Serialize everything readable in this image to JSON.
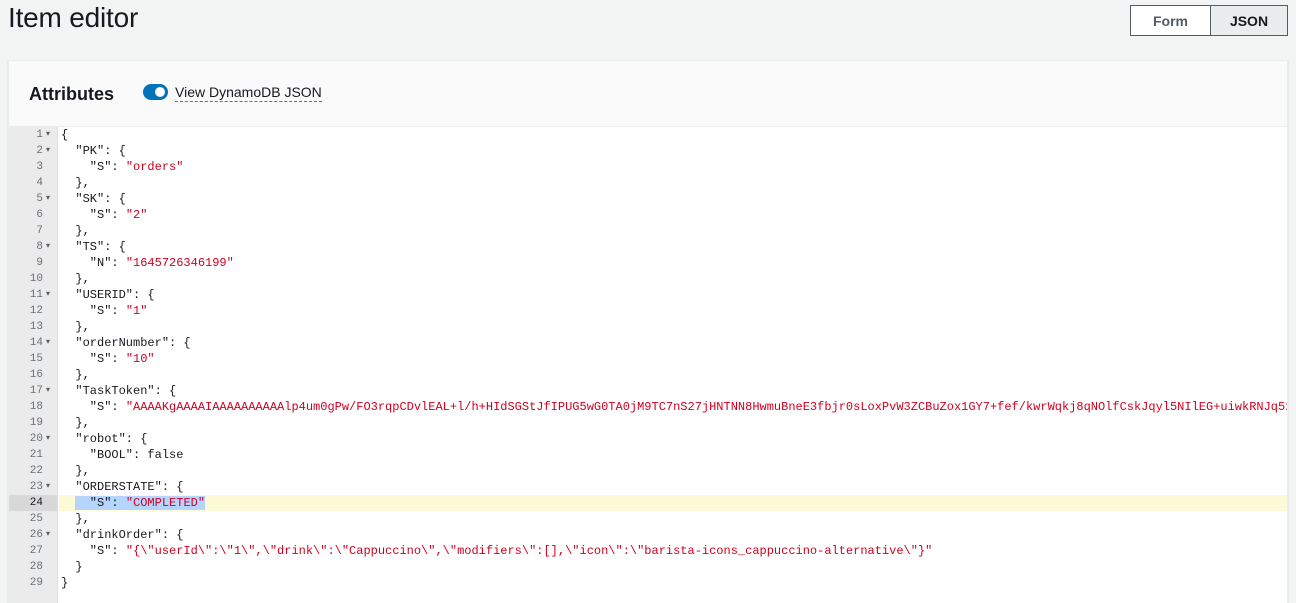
{
  "page": {
    "title": "Item editor"
  },
  "view_toggle": {
    "form_label": "Form",
    "json_label": "JSON",
    "selected": "JSON"
  },
  "panel": {
    "title": "Attributes",
    "toggle_label": "View DynamoDB JSON",
    "toggle_on": true
  },
  "editor": {
    "active_line": 24,
    "lines": [
      {
        "n": "1",
        "fold": true,
        "segs": [
          [
            "p",
            "{"
          ]
        ]
      },
      {
        "n": "2",
        "fold": true,
        "segs": [
          [
            "p",
            "  \"PK\": {"
          ]
        ]
      },
      {
        "n": "3",
        "fold": false,
        "segs": [
          [
            "p",
            "    \"S\": "
          ],
          [
            "s",
            "\"orders\""
          ]
        ]
      },
      {
        "n": "4",
        "fold": false,
        "segs": [
          [
            "p",
            "  },"
          ]
        ]
      },
      {
        "n": "5",
        "fold": true,
        "segs": [
          [
            "p",
            "  \"SK\": {"
          ]
        ]
      },
      {
        "n": "6",
        "fold": false,
        "segs": [
          [
            "p",
            "    \"S\": "
          ],
          [
            "s",
            "\"2\""
          ]
        ]
      },
      {
        "n": "7",
        "fold": false,
        "segs": [
          [
            "p",
            "  },"
          ]
        ]
      },
      {
        "n": "8",
        "fold": true,
        "segs": [
          [
            "p",
            "  \"TS\": {"
          ]
        ]
      },
      {
        "n": "9",
        "fold": false,
        "segs": [
          [
            "p",
            "    \"N\": "
          ],
          [
            "s",
            "\"1645726346199\""
          ]
        ]
      },
      {
        "n": "10",
        "fold": false,
        "segs": [
          [
            "p",
            "  },"
          ]
        ]
      },
      {
        "n": "11",
        "fold": true,
        "segs": [
          [
            "p",
            "  \"USERID\": {"
          ]
        ]
      },
      {
        "n": "12",
        "fold": false,
        "segs": [
          [
            "p",
            "    \"S\": "
          ],
          [
            "s",
            "\"1\""
          ]
        ]
      },
      {
        "n": "13",
        "fold": false,
        "segs": [
          [
            "p",
            "  },"
          ]
        ]
      },
      {
        "n": "14",
        "fold": true,
        "segs": [
          [
            "p",
            "  \"orderNumber\": {"
          ]
        ]
      },
      {
        "n": "15",
        "fold": false,
        "segs": [
          [
            "p",
            "    \"S\": "
          ],
          [
            "s",
            "\"10\""
          ]
        ]
      },
      {
        "n": "16",
        "fold": false,
        "segs": [
          [
            "p",
            "  },"
          ]
        ]
      },
      {
        "n": "17",
        "fold": true,
        "segs": [
          [
            "p",
            "  \"TaskToken\": {"
          ]
        ]
      },
      {
        "n": "18",
        "fold": false,
        "segs": [
          [
            "p",
            "    \"S\": "
          ],
          [
            "s",
            "\"AAAAKgAAAAIAAAAAAAAAAlp4um0gPw/FO3rqpCDvlEAL+l/h+HIdSGStJfIPUG5wG0TA0jM9TC7nS27jHNTNN8HwmuBneE3fbjr0sLoxPvW3ZCBuZox1GY7+fef/kwrWqkj8qNOlfCskJqyl5NIlEG+uiwkRNJq5x"
          ]
        ]
      },
      {
        "n": "19",
        "fold": false,
        "segs": [
          [
            "p",
            "  },"
          ]
        ]
      },
      {
        "n": "20",
        "fold": true,
        "segs": [
          [
            "p",
            "  \"robot\": {"
          ]
        ]
      },
      {
        "n": "21",
        "fold": false,
        "segs": [
          [
            "p",
            "    \"BOOL\": false"
          ]
        ]
      },
      {
        "n": "22",
        "fold": false,
        "segs": [
          [
            "p",
            "  },"
          ]
        ]
      },
      {
        "n": "23",
        "fold": true,
        "segs": [
          [
            "p",
            "  \"ORDERSTATE\": {"
          ]
        ]
      },
      {
        "n": "24",
        "fold": false,
        "segs": [
          [
            "p",
            "  "
          ],
          [
            "x",
            "  \"S\": "
          ],
          [
            "xs",
            "\"COMPLETED\""
          ]
        ]
      },
      {
        "n": "25",
        "fold": false,
        "segs": [
          [
            "p",
            "  },"
          ]
        ]
      },
      {
        "n": "26",
        "fold": true,
        "segs": [
          [
            "p",
            "  \"drinkOrder\": {"
          ]
        ]
      },
      {
        "n": "27",
        "fold": false,
        "segs": [
          [
            "p",
            "    \"S\": "
          ],
          [
            "s",
            "\"{\\\"userId\\\":\\\"1\\\",\\\"drink\\\":\\\"Cappuccino\\\",\\\"modifiers\\\":[],\\\"icon\\\":\\\"barista-icons_cappuccino-alternative\\\"}\""
          ]
        ]
      },
      {
        "n": "28",
        "fold": false,
        "segs": [
          [
            "p",
            "  }"
          ]
        ]
      },
      {
        "n": "29",
        "fold": false,
        "segs": [
          [
            "p",
            "}"
          ]
        ]
      }
    ]
  }
}
